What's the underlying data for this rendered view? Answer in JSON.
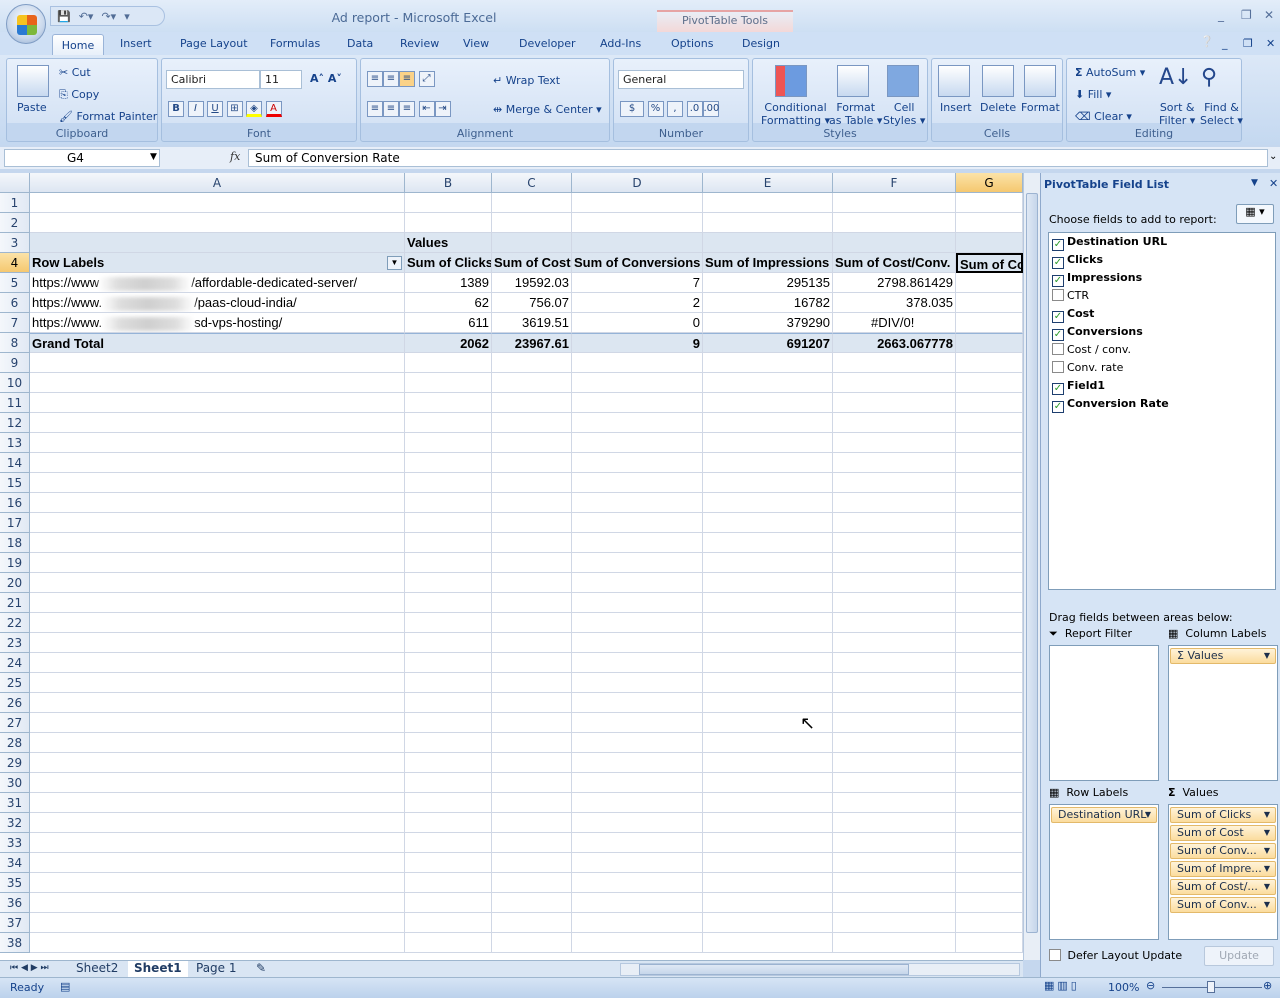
{
  "window": {
    "title": "Ad report - Microsoft Excel",
    "context_tab_group": "PivotTable Tools"
  },
  "tabs": [
    "Home",
    "Insert",
    "Page Layout",
    "Formulas",
    "Data",
    "Review",
    "View",
    "Developer",
    "Add-Ins",
    "Options",
    "Design"
  ],
  "ribbon": {
    "clipboard": {
      "label": "Clipboard",
      "paste": "Paste",
      "cut": "Cut",
      "copy": "Copy",
      "format_painter": "Format Painter"
    },
    "font": {
      "label": "Font",
      "name": "Calibri",
      "size": "11"
    },
    "alignment": {
      "label": "Alignment",
      "wrap_text": "Wrap Text",
      "merge_center": "Merge & Center"
    },
    "number": {
      "label": "Number",
      "format": "General",
      "currency": "$",
      "percent": "%",
      "comma": ","
    },
    "styles": {
      "label": "Styles",
      "conditional_1": "Conditional",
      "conditional_2": "Formatting",
      "format_table_1": "Format",
      "format_table_2": "as Table",
      "cell_styles_1": "Cell",
      "cell_styles_2": "Styles"
    },
    "cells": {
      "label": "Cells",
      "insert": "Insert",
      "delete": "Delete",
      "format": "Format"
    },
    "editing": {
      "label": "Editing",
      "autosum": "AutoSum",
      "fill": "Fill",
      "clear": "Clear",
      "sort_1": "Sort &",
      "sort_2": "Filter",
      "find_1": "Find &",
      "find_2": "Select"
    }
  },
  "formula_bar": {
    "name_box": "G4",
    "fx": "fx",
    "formula": "Sum of Conversion Rate"
  },
  "grid": {
    "columns": [
      "A",
      "B",
      "C",
      "D",
      "E",
      "F",
      "G"
    ],
    "selected_cell": "G4",
    "row_count": 38,
    "values_label": "Values",
    "row_labels": "Row Labels",
    "headers": [
      "Sum of Clicks",
      "Sum of Cost",
      "Sum of Conversions",
      "Sum of Impressions",
      "Sum of Cost/Conv.",
      "Sum of Conversion Rate"
    ],
    "rows": [
      {
        "url_prefix": "https://www",
        "url_suffix": "/affordable-dedicated-server/",
        "values": [
          "1389",
          "19592.03",
          "7",
          "295135",
          "2798.861429",
          ""
        ]
      },
      {
        "url_prefix": "https://www.",
        "url_suffix": "/paas-cloud-india/",
        "values": [
          "62",
          "756.07",
          "2",
          "16782",
          "378.035",
          ""
        ]
      },
      {
        "url_prefix": "https://www.",
        "url_suffix": "sd-vps-hosting/",
        "values": [
          "611",
          "3619.51",
          "0",
          "379290",
          "#DIV/0!",
          ""
        ]
      }
    ],
    "grand_total": {
      "label": "Grand Total",
      "values": [
        "2062",
        "23967.61",
        "9",
        "691207",
        "2663.067778",
        ""
      ]
    }
  },
  "sheet_tabs": [
    "Sheet2",
    "Sheet1",
    "Page 1"
  ],
  "active_sheet": "Sheet1",
  "status": {
    "ready": "Ready",
    "zoom": "100%"
  },
  "pivot_pane": {
    "title": "PivotTable Field List",
    "choose": "Choose fields to add to report:",
    "fields": [
      {
        "name": "Destination URL",
        "checked": true
      },
      {
        "name": "Clicks",
        "checked": true
      },
      {
        "name": "Impressions",
        "checked": true
      },
      {
        "name": "CTR",
        "checked": false
      },
      {
        "name": "Cost",
        "checked": true
      },
      {
        "name": "Conversions",
        "checked": true
      },
      {
        "name": "Cost / conv.",
        "checked": false
      },
      {
        "name": "Conv. rate",
        "checked": false
      },
      {
        "name": "Field1",
        "checked": true
      },
      {
        "name": "Conversion Rate",
        "checked": true
      }
    ],
    "drag_label": "Drag fields between areas below:",
    "report_filter": "Report Filter",
    "column_labels": "Column Labels",
    "row_labels": "Row Labels",
    "values": "Values",
    "column_items": [
      "Values"
    ],
    "row_items": [
      "Destination URL"
    ],
    "value_items": [
      "Sum of Clicks",
      "Sum of Cost",
      "Sum of Conv...",
      "Sum of Impre...",
      "Sum of Cost/...",
      "Sum of Conv..."
    ],
    "defer": "Defer Layout Update",
    "update": "Update"
  },
  "colors": {
    "pivot_header": "#dce6f1",
    "selection": "#f5c870",
    "ribbon": "#c4d8f0"
  }
}
